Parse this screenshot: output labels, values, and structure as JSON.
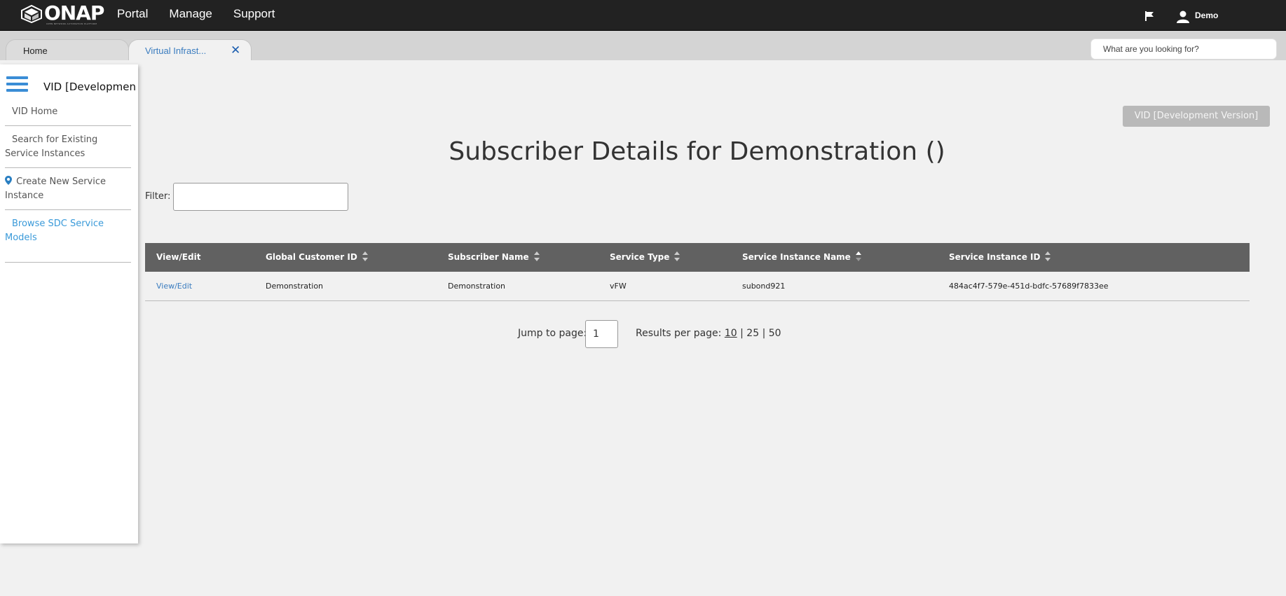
{
  "header": {
    "logo_text": "ONAP",
    "logo_tagline": "OPEN NETWORK AUTOMATION PLATFORM",
    "nav": [
      "Portal",
      "Manage",
      "Support"
    ],
    "icons": [
      "flag-icon",
      "user-icon"
    ],
    "username": "Demo"
  },
  "tabs": {
    "home": "Home",
    "active": "Virtual Infrast...",
    "close_icon": "close-icon"
  },
  "search": {
    "placeholder": "What are you looking for?"
  },
  "sidebar": {
    "title": "VID [Developmen",
    "items": [
      {
        "label": "VID Home"
      },
      {
        "label": "Search for Existing Service Instances"
      },
      {
        "label": "Create New Service Instance",
        "icon": "location-pin-icon"
      },
      {
        "label": "Browse SDC Service Models"
      }
    ]
  },
  "main": {
    "version_button": "VID [Development Version]",
    "title": "Subscriber Details for Demonstration ()",
    "filter_label": "Filter:",
    "filter_value": "",
    "table": {
      "columns": [
        "View/Edit",
        "Global Customer ID",
        "Subscriber Name",
        "Service Type",
        "Service Instance Name",
        "Service Instance ID"
      ],
      "rows": [
        [
          "View/Edit",
          "Demonstration",
          "Demonstration",
          "vFW",
          "subond921",
          "484ac4f7-579e-451d-bdfc-57689f7833ee"
        ]
      ]
    },
    "pagination": {
      "jump_label": "Jump to page:",
      "jump_value": "1",
      "results_label": "Results per page:",
      "options": [
        "10",
        "25",
        "50"
      ],
      "separator": "|"
    }
  },
  "colors": {
    "topbar": "#222222",
    "accent": "#3a8dd6",
    "table_header": "#616161",
    "link": "#3a7cbf"
  }
}
